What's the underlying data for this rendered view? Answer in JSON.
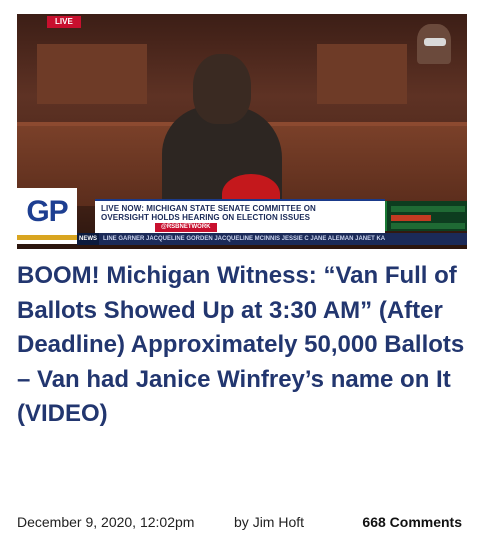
{
  "hero": {
    "live_badge": "LIVE",
    "lower_third": {
      "line1": "LIVE NOW: MICHIGAN STATE SENATE COMMITTEE ON",
      "line2": "OVERSIGHT HOLDS HEARING ON ELECTION ISSUES",
      "network": "@RSBNETWORK"
    },
    "ticker_tag": "NEWS",
    "ticker": "LINE GARNER  JACQUELINE GORDEN  JACQUELINE MCINNIS  JESSIE C  JANE ALEMAN  JANET KA"
  },
  "logo": {
    "text": "GP",
    "colors": {
      "primary": "#1d3e91",
      "accent": "#d9a520"
    }
  },
  "article": {
    "title": "BOOM! Michigan Witness: “Van Full of Ballots Showed Up at 3:30 AM” (After Deadline) Approximately 50,000 Ballots – Van had Janice Winfrey’s name on It (VIDEO)",
    "date": "December 9, 2020, 12:02pm",
    "author_prefix": "by ",
    "author": "Jim Hoft",
    "comments": "668 Comments",
    "colors": {
      "title": "#22366f",
      "breaking_red": "#c8102e"
    }
  }
}
